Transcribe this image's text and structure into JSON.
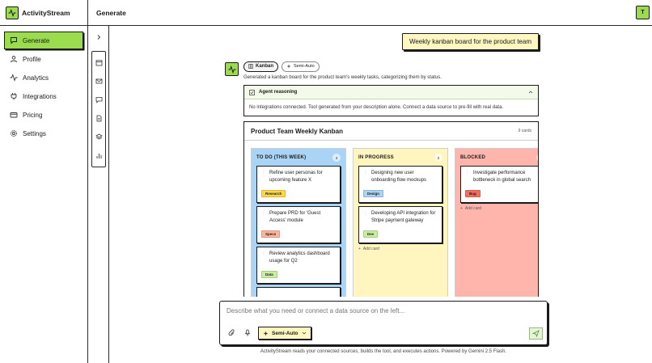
{
  "app": {
    "name": "ActivityStream"
  },
  "header": {
    "title": "Generate",
    "avatar_initial": "T"
  },
  "sidebar": {
    "items": [
      {
        "label": "Generate",
        "icon": "chat-icon",
        "active": true
      },
      {
        "label": "Profile",
        "icon": "user-icon"
      },
      {
        "label": "Analytics",
        "icon": "activity-icon"
      },
      {
        "label": "Integrations",
        "icon": "plug-icon"
      },
      {
        "label": "Pricing",
        "icon": "card-icon"
      },
      {
        "label": "Settings",
        "icon": "gear-icon"
      }
    ]
  },
  "rail": {
    "icons": [
      "calendar-icon",
      "mail-icon",
      "message-icon",
      "document-icon",
      "layers-icon",
      "chart-icon"
    ]
  },
  "conversation": {
    "user_message": "Weekly kanban board for the product team",
    "response": {
      "tag_primary": "Kanban",
      "tag_mode": "Semi-Auto",
      "description": "Generated a kanban board for the product team's weekly tasks, categorizing them by status.",
      "reasoning": {
        "title": "Agent reasoning",
        "body": "No integrations connected. Tool generated from your description alone. Connect a data source to pre-fill with real data."
      },
      "kanban": {
        "title": "Product Team Weekly Kanban",
        "count_label": "9 cards",
        "add_card_label": "Add card",
        "columns": [
          {
            "title": "TO DO (THIS WEEK)",
            "count": "4",
            "bg": "#a9d4f5",
            "cards": [
              {
                "title": "Refine user personas for upcoming feature X",
                "tag": "Research",
                "tag_bg": "#ffd84a"
              },
              {
                "title": "Prepare PRD for 'Guest Access' module",
                "tag": "Specs",
                "tag_bg": "#ffb59a"
              },
              {
                "title": "Review analytics dashboard usage for Q2",
                "tag": "Data",
                "tag_bg": "#c7ef9d"
              }
            ]
          },
          {
            "title": "IN PROGRESS",
            "count": "2",
            "bg": "#fff6bf",
            "cards": [
              {
                "title": "Designing new user onboarding flow mockups",
                "tag": "Design",
                "tag_bg": "#a9d4f5"
              },
              {
                "title": "Developing API integration for Stripe payment gateway",
                "tag": "Dev",
                "tag_bg": "#c7ef9d"
              }
            ]
          },
          {
            "title": "BLOCKED",
            "count": "1",
            "bg": "#ffb4ac",
            "cards": [
              {
                "title": "Investigate performance bottleneck in global search",
                "tag": "Bug",
                "tag_bg": "#ff6b5b"
              }
            ]
          }
        ]
      }
    }
  },
  "composer": {
    "placeholder": "Describe what you need or connect a data source on the left...",
    "mode_label": "Semi-Auto",
    "footer": "ActivityStream reads your connected sources, builds the tool, and executes actions. Powered by Gemini 2.5 Flash."
  },
  "colors": {
    "accent": "#9bdc4f",
    "highlight": "#fff7c2",
    "border": "#1a1a1a"
  }
}
